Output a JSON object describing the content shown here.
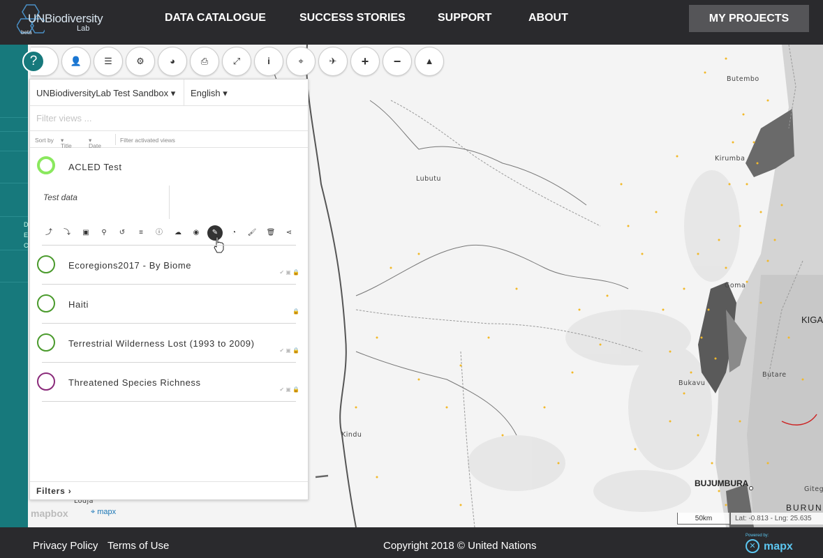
{
  "header": {
    "logo": {
      "line1": "UNBiodiversity",
      "line2": "Lab",
      "badge": "beta"
    },
    "nav": [
      "DATA CATALOGUE",
      "SUCCESS STORIES",
      "SUPPORT",
      "ABOUT"
    ],
    "my_projects": "MY PROJECTS"
  },
  "sidebar": {
    "help_glyph": "?",
    "partial_letters": [
      "D",
      "E",
      "C"
    ]
  },
  "toolbar": [
    {
      "icon": "user-icon",
      "glyph": "👤"
    },
    {
      "icon": "list-icon",
      "glyph": "☰"
    },
    {
      "icon": "cogs-icon",
      "glyph": "⚙"
    },
    {
      "icon": "pie-chart-icon",
      "glyph": "◕"
    },
    {
      "icon": "print-icon",
      "glyph": "⎙"
    },
    {
      "icon": "expand-icon",
      "glyph": "⤢"
    },
    {
      "icon": "info-icon",
      "glyph": "i"
    },
    {
      "icon": "map-marker-icon",
      "glyph": "⌖"
    },
    {
      "icon": "plane-icon",
      "glyph": "✈"
    },
    {
      "icon": "zoom-in-icon",
      "glyph": "+"
    },
    {
      "icon": "zoom-out-icon",
      "glyph": "−"
    },
    {
      "icon": "north-arrow-icon",
      "glyph": "▲"
    }
  ],
  "panel": {
    "project_select": "UNBiodiversityLab Test Sandbox",
    "language_select": "English",
    "filter_placeholder": "Filter views ...",
    "sort": {
      "label": "Sort by",
      "title": "Title",
      "date": "Date",
      "activated": "Filter activated views"
    },
    "views": [
      {
        "title": "ACLED Test",
        "color": "#7ee35a",
        "active": true
      },
      {
        "title": "Ecoregions2017 - By Biome",
        "color": "#4a9a2c"
      },
      {
        "title": "Haiti",
        "color": "#4a9a2c"
      },
      {
        "title": "Terrestrial Wilderness Lost (1993 to 2009)",
        "color": "#4a9a2c"
      },
      {
        "title": "Threatened Species Richness",
        "color": "#8a2a7a"
      }
    ],
    "active_description": "Test data",
    "view_tools": [
      "⤴",
      "⤵",
      "▣",
      "⚲",
      "↺",
      "≡",
      "ⓘ",
      "☁",
      "◉",
      "✎",
      "◔",
      "🖌",
      "🗑",
      "⋖"
    ],
    "filters_label": "Filters ›"
  },
  "map": {
    "places": [
      {
        "name": "Butembo"
      },
      {
        "name": "Kirumba"
      },
      {
        "name": "Lubutu"
      },
      {
        "name": "Goma"
      },
      {
        "name": "Bukavu"
      },
      {
        "name": "Butare"
      },
      {
        "name": "Kindu"
      },
      {
        "name": "Lodja"
      }
    ],
    "big_places": [
      "BUJUMBURA",
      "KIGA",
      "BURUN",
      "Gitega"
    ],
    "scale": "50km",
    "coords": "Lat: -0.813 - Lng: 25.635",
    "mapbox_label": "mapbox",
    "mapx_label": "mapx"
  },
  "footer": {
    "privacy": "Privacy Policy",
    "terms": "Terms of Use",
    "copyright": "Copyright 2018 © United Nations",
    "powered_by": "Powered by:",
    "brand": "mapx"
  }
}
